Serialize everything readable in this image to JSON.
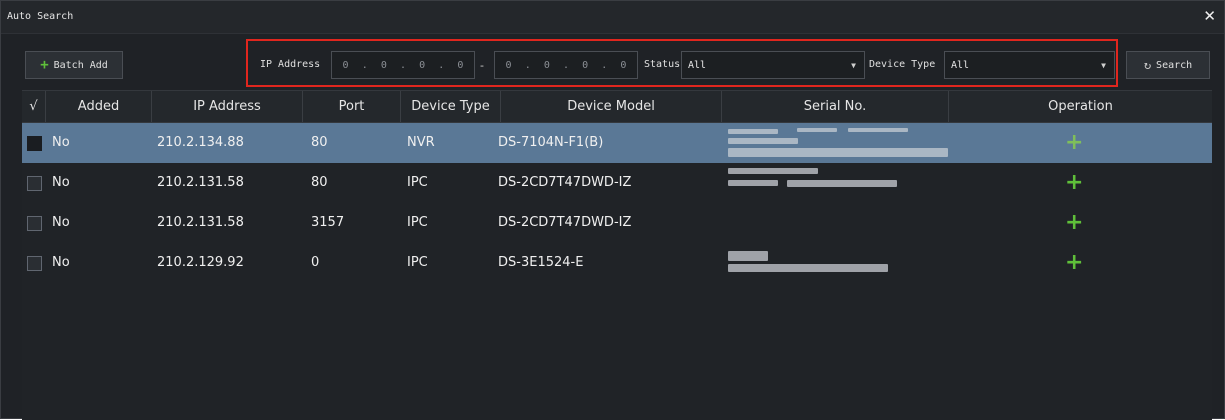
{
  "window": {
    "title": "Auto Search",
    "close_icon": "close-icon"
  },
  "toolbar": {
    "batch_add_label": "Batch Add",
    "search_label": "Search",
    "ip_address_label": "IP Address",
    "ip_start": [
      "0",
      ".",
      "0",
      ".",
      "0",
      ".",
      "0"
    ],
    "ip_dash": "-",
    "ip_end": [
      "0",
      ".",
      "0",
      ".",
      "0",
      ".",
      "0"
    ],
    "status_label": "Status",
    "status_value": "All",
    "device_type_label": "Device Type",
    "device_type_value": "All"
  },
  "table": {
    "headers": [
      "√",
      "Added",
      "IP Address",
      "Port",
      "Device Type",
      "Device Model",
      "Serial No.",
      "Operation"
    ],
    "rows": [
      {
        "added": "No",
        "ip": "210.2.134.88",
        "port": "80",
        "type": "NVR",
        "model": "DS-7104N-F1(B)",
        "selected": true
      },
      {
        "added": "No",
        "ip": "210.2.131.58",
        "port": "80",
        "type": "IPC",
        "model": "DS-2CD7T47DWD-IZ",
        "selected": false
      },
      {
        "added": "No",
        "ip": "210.2.131.58",
        "port": "3157",
        "type": "IPC",
        "model": "DS-2CD7T47DWD-IZ",
        "selected": false
      },
      {
        "added": "No",
        "ip": "210.2.129.92",
        "port": "0",
        "type": "IPC",
        "model": "DS-3E1524-E",
        "selected": false
      }
    ],
    "operation_icon": "add-icon"
  },
  "colors": {
    "accent_green": "#5fbf3a",
    "highlight_red": "#e0261e",
    "selected_row": "#5a7896"
  }
}
